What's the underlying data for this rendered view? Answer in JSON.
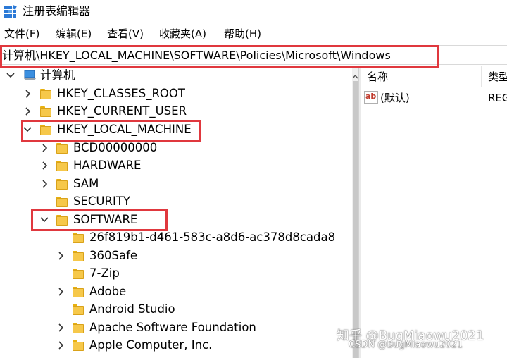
{
  "window": {
    "title": "注册表编辑器"
  },
  "menu": [
    "文件(F)",
    "编辑(E)",
    "查看(V)",
    "收藏夹(A)",
    "帮助(H)"
  ],
  "address": "计算机\\HKEY_LOCAL_MACHINE\\SOFTWARE\\Policies\\Microsoft\\Windows",
  "tree": {
    "root": "计算机",
    "nodes": [
      "HKEY_CLASSES_ROOT",
      "HKEY_CURRENT_USER",
      "HKEY_LOCAL_MACHINE",
      "BCD00000000",
      "HARDWARE",
      "SAM",
      "SECURITY",
      "SOFTWARE",
      "26f819b1-d461-583c-a8d6-ac378d8cada8",
      "360Safe",
      "7-Zip",
      "Adobe",
      "Android Studio",
      "Apache Software Foundation",
      "Apple Computer, Inc."
    ]
  },
  "list": {
    "columns": [
      "名称",
      "类型"
    ],
    "rows": [
      {
        "name": "(默认)",
        "type": "REG"
      }
    ],
    "value_icon_text": "ab"
  },
  "watermark": {
    "main": "知乎 @BugMiaowu2021",
    "sub": "CSDN @BugMiaowu2021"
  },
  "colors": {
    "highlight": "#e0383e",
    "folder": "#f6c84a"
  }
}
